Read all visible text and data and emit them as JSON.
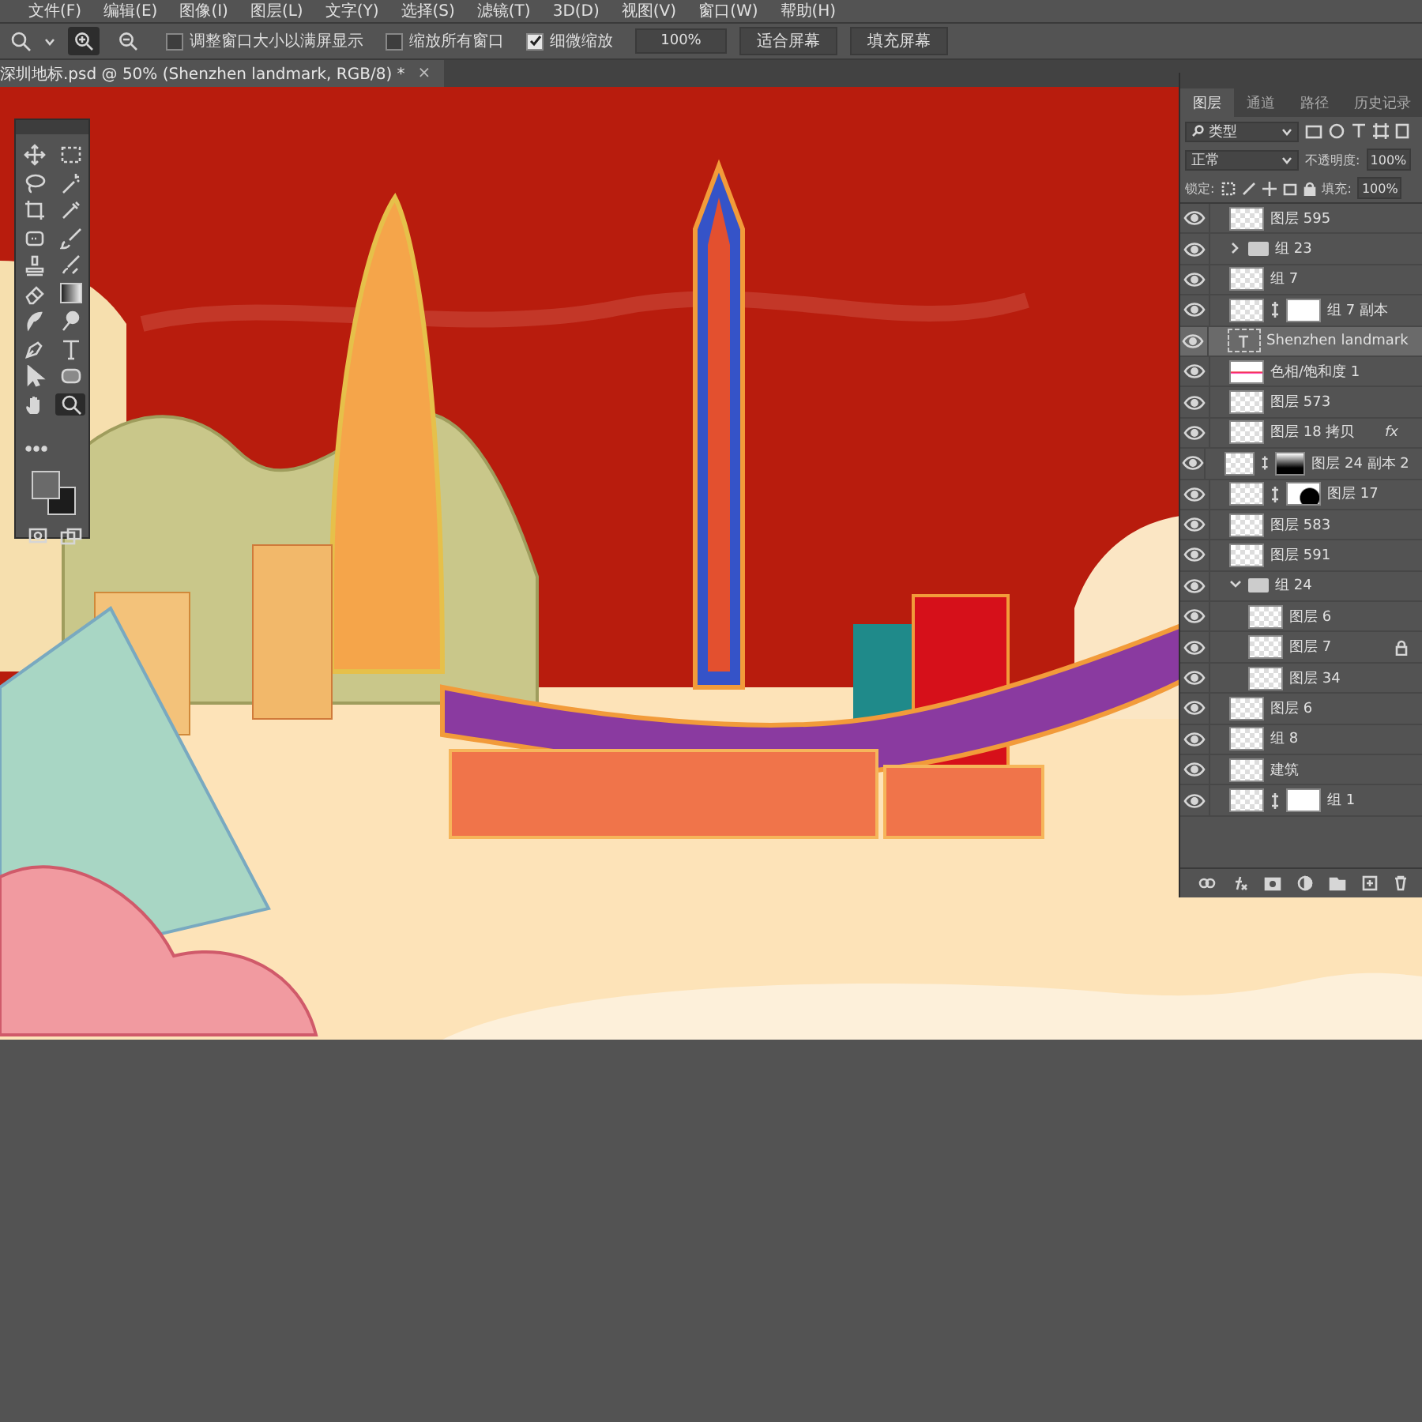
{
  "menu": [
    "文件(F)",
    "编辑(E)",
    "图像(I)",
    "图层(L)",
    "文字(Y)",
    "选择(S)",
    "滤镜(T)",
    "3D(D)",
    "视图(V)",
    "窗口(W)",
    "帮助(H)"
  ],
  "options": {
    "zoom_modes": [
      {
        "kind": "zoom-in",
        "selected": true
      },
      {
        "kind": "zoom-out",
        "selected": false
      }
    ],
    "checkboxes": [
      {
        "label": "调整窗口大小以满屏显示",
        "checked": false
      },
      {
        "label": "缩放所有窗口",
        "checked": false
      },
      {
        "label": "细微缩放",
        "checked": true
      }
    ],
    "zoom_value": "100%",
    "buttons": [
      "适合屏幕",
      "填充屏幕"
    ]
  },
  "document_tab": {
    "title": "深圳地标.psd @ 50% (Shenzhen landmark, RGB/8) *",
    "close": "×"
  },
  "tools": [
    {
      "kind": "move",
      "selected": false
    },
    {
      "kind": "marquee",
      "selected": false
    },
    {
      "kind": "lasso",
      "selected": false
    },
    {
      "kind": "wand",
      "selected": false
    },
    {
      "kind": "crop",
      "selected": false
    },
    {
      "kind": "eyedropper",
      "selected": false
    },
    {
      "kind": "patch",
      "selected": false
    },
    {
      "kind": "brush",
      "selected": false
    },
    {
      "kind": "stamp",
      "selected": false
    },
    {
      "kind": "history",
      "selected": false
    },
    {
      "kind": "eraser",
      "selected": false
    },
    {
      "kind": "gradient",
      "selected": false
    },
    {
      "kind": "smudge",
      "selected": false
    },
    {
      "kind": "dodge",
      "selected": false
    },
    {
      "kind": "pen",
      "selected": false
    },
    {
      "kind": "type",
      "selected": false
    },
    {
      "kind": "arrow",
      "selected": false
    },
    {
      "kind": "shape",
      "selected": false
    },
    {
      "kind": "hand",
      "selected": false
    },
    {
      "kind": "zoom",
      "selected": true
    }
  ],
  "layers_panel": {
    "tabs": [
      {
        "label": "图层",
        "selected": true
      },
      {
        "label": "通道",
        "selected": false
      },
      {
        "label": "路径",
        "selected": false
      },
      {
        "label": "历史记录",
        "selected": false
      }
    ],
    "filter": "类型",
    "blend_mode": "正常",
    "opacity_label": "不透明度:",
    "opacity": "100%",
    "lock_label": "锁定:",
    "fill_label": "填充:",
    "fill": "100%",
    "layers": [
      {
        "name": "图层 595",
        "kind": "pixel",
        "visible": true,
        "selected": false
      },
      {
        "name": "组 23",
        "kind": "group",
        "visible": true,
        "selected": false,
        "expanded": false
      },
      {
        "name": "组 7",
        "kind": "pixel",
        "visible": true,
        "selected": false
      },
      {
        "name": "组 7 副本",
        "kind": "pixel",
        "visible": true,
        "selected": false,
        "mask": {
          "kind": "white"
        }
      },
      {
        "name": "Shenzhen landmark",
        "kind": "text",
        "visible": true,
        "selected": true
      },
      {
        "name": "色相/饱和度 1",
        "kind": "adjustment",
        "visible": true,
        "selected": false
      },
      {
        "name": "图层 573",
        "kind": "pixel",
        "visible": true,
        "selected": false
      },
      {
        "name": "图层 18 拷贝",
        "kind": "pixel",
        "visible": true,
        "selected": false,
        "fx": "fx"
      },
      {
        "name": "图层 24 副本 2",
        "kind": "pixel",
        "visible": true,
        "selected": false,
        "mask": {
          "kind": "gradient"
        }
      },
      {
        "name": "图层 17",
        "kind": "pixel",
        "visible": true,
        "selected": false,
        "mask": {
          "kind": "blob"
        }
      },
      {
        "name": "图层 583",
        "kind": "pixel",
        "visible": true,
        "selected": false
      },
      {
        "name": "图层 591",
        "kind": "pixel",
        "visible": true,
        "selected": false
      },
      {
        "name": "组 24",
        "kind": "group",
        "visible": true,
        "selected": false,
        "expanded": true,
        "children": [
          {
            "name": "图层 6",
            "kind": "pixel",
            "visible": true,
            "selected": false,
            "locked": false
          },
          {
            "name": "图层 7",
            "kind": "pixel",
            "visible": true,
            "selected": false,
            "locked": true
          },
          {
            "name": "图层 34",
            "kind": "pixel",
            "visible": true,
            "selected": false,
            "locked": false
          }
        ]
      },
      {
        "name": "图层 6",
        "kind": "pixel",
        "visible": true,
        "selected": false
      },
      {
        "name": "组 8",
        "kind": "pixel",
        "visible": true,
        "selected": false
      },
      {
        "name": "建筑",
        "kind": "pixel",
        "visible": true,
        "selected": false
      },
      {
        "name": "组 1",
        "kind": "pixel",
        "visible": true,
        "selected": false,
        "mask": {
          "kind": "white"
        }
      }
    ]
  }
}
